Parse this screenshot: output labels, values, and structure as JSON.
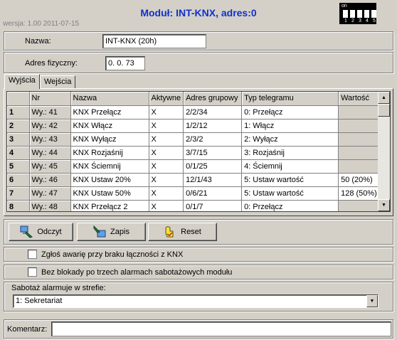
{
  "header": {
    "title": "Moduł: INT-KNX, adres:0",
    "version": "wersja: 1.00 2011-07-15",
    "dip": {
      "on_label": "on",
      "numbers": [
        "1",
        "2",
        "3",
        "4",
        "5"
      ]
    }
  },
  "form": {
    "name_label": "Nazwa:",
    "name_value": "INT-KNX   (20h)",
    "addr_label": "Adres fizyczny:",
    "addr_value": "0. 0. 73"
  },
  "tabs": [
    {
      "label": "Wyjścia",
      "active": true
    },
    {
      "label": "Wejścia",
      "active": false
    }
  ],
  "table": {
    "columns": [
      "",
      "Nr",
      "Nazwa",
      "Aktywne",
      "Adres grupowy",
      "Typ telegramu",
      "Wartość"
    ],
    "rows": [
      {
        "n": "1",
        "nr": "Wy.: 41",
        "name": "KNX Przełącz",
        "active": "X",
        "group": "2/2/34",
        "type": "0: Przełącz",
        "value": ""
      },
      {
        "n": "2",
        "nr": "Wy.: 42",
        "name": "KNX Włącz",
        "active": "X",
        "group": "1/2/12",
        "type": "1: Włącz",
        "value": ""
      },
      {
        "n": "3",
        "nr": "Wy.: 43",
        "name": "KNX Wyłącz",
        "active": "X",
        "group": "2/3/2",
        "type": "2: Wyłącz",
        "value": ""
      },
      {
        "n": "4",
        "nr": "Wy.: 44",
        "name": "KNX Rozjaśnij",
        "active": "X",
        "group": "3/7/15",
        "type": "3: Rozjaśnij",
        "value": ""
      },
      {
        "n": "5",
        "nr": "Wy.: 45",
        "name": "KNX Ściemnij",
        "active": "X",
        "group": "0/1/25",
        "type": "4: Ściemnij",
        "value": ""
      },
      {
        "n": "6",
        "nr": "Wy.: 46",
        "name": "KNX Ustaw 20%",
        "active": "X",
        "group": "12/1/43",
        "type": "5: Ustaw wartość",
        "value": "50 (20%)"
      },
      {
        "n": "7",
        "nr": "Wy.: 47",
        "name": "KNX Ustaw 50%",
        "active": "X",
        "group": "0/6/21",
        "type": "5: Ustaw wartość",
        "value": "128 (50%)"
      },
      {
        "n": "8",
        "nr": "Wy.: 48",
        "name": "KNX Przełącz 2",
        "active": "X",
        "group": "0/1/7",
        "type": "0: Przełącz",
        "value": ""
      }
    ]
  },
  "buttons": {
    "read": "Odczyt",
    "save": "Zapis",
    "reset": "Reset"
  },
  "options": {
    "report_failure": "Zgłoś awarię przy braku łączności z KNX",
    "no_block": "Bez blokady po trzech alarmach sabotażowych modułu"
  },
  "tamper": {
    "label": "Sabotaż alarmuje w strefie:",
    "selected": "1: Sekretariat"
  },
  "comment": {
    "label": "Komentarz:",
    "value": ""
  }
}
